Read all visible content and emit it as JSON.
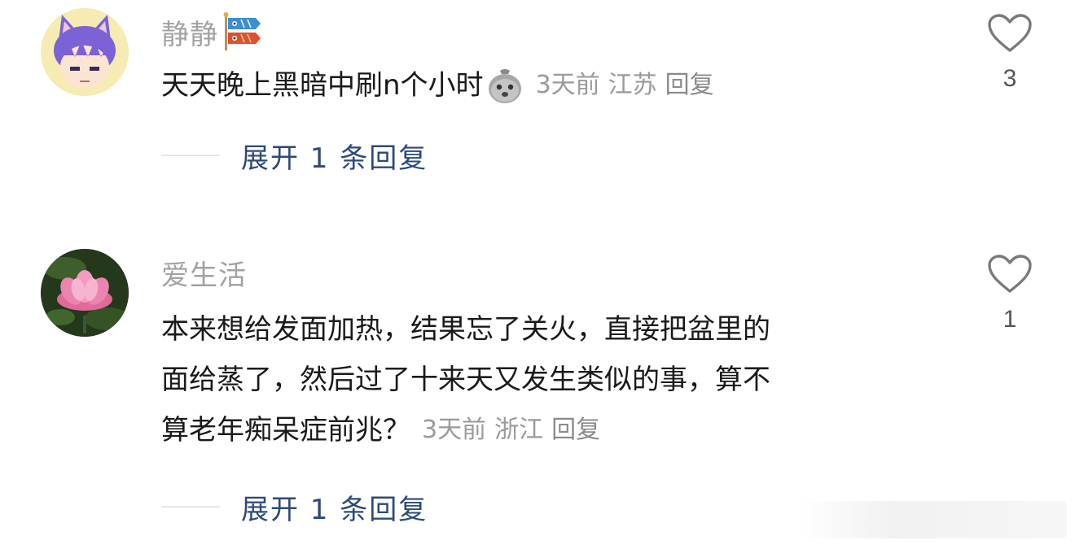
{
  "comments": [
    {
      "username": "静静",
      "text": "天天晚上黑暗中刷n个小时",
      "emoji_icon": "sad-face-emoji-icon",
      "time": "3天前",
      "location": "江苏",
      "reply_label": "回复",
      "expand_label": "展开 1 条回复",
      "like_count": "3",
      "avatar_icon": "anime-catgirl-avatar",
      "badge_icon": "koinobori-badge-icon"
    },
    {
      "username": "爱生活",
      "text_lines": [
        "本来想给发面加热，结果忘了关火，直接把盆里的",
        "面给蒸了，然后过了十来天又发生类似的事，算不",
        "算老年痴呆症前兆？"
      ],
      "time": "3天前",
      "location": "浙江",
      "reply_label": "回复",
      "expand_label": "展开 1 条回复",
      "like_count": "1",
      "avatar_icon": "lotus-flower-avatar"
    }
  ],
  "colors": {
    "username": "#a2a2a2",
    "body_text": "#1a1a1a",
    "meta": "#9a9a9a",
    "expand_link": "#2c4a7a",
    "heart_outline": "#7a7a7a"
  }
}
